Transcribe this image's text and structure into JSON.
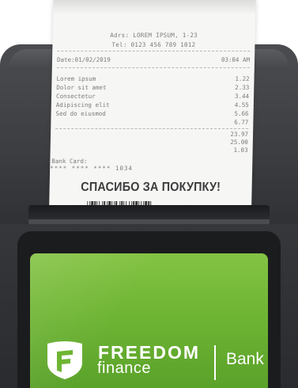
{
  "receipt": {
    "address": "Adrs: LOREM IPSUM, 1-23",
    "tel": "Tel: 0123 456 789 1012",
    "date": "Date:01/02/2019",
    "time": "03:04 AM",
    "items": [
      {
        "name": "Lorem ipsum",
        "price": "1.22"
      },
      {
        "name": "Dolor sit amet",
        "price": "2.33"
      },
      {
        "name": "Consectetur",
        "price": "3.44"
      },
      {
        "name": "Adipiscing elit",
        "price": "4.55"
      },
      {
        "name": "Sed do eiusmod",
        "price": "5.66"
      },
      {
        "name": "",
        "price": "6.77"
      }
    ],
    "totals": [
      "23.97",
      "25.00",
      "1.03"
    ],
    "card_label": "Bank Card:",
    "card_number": "**** **** **** 1034",
    "thanks": "СПАСИБО ЗА ПОКУПКУ!"
  },
  "screen": {
    "brand_line1": "FREEDOM",
    "brand_line2": "finance",
    "brand_bank": "Bank"
  },
  "colors": {
    "screen_green": "#6fb534",
    "terminal_dark": "#3b3d40",
    "receipt_paper": "#f6f6f5"
  }
}
